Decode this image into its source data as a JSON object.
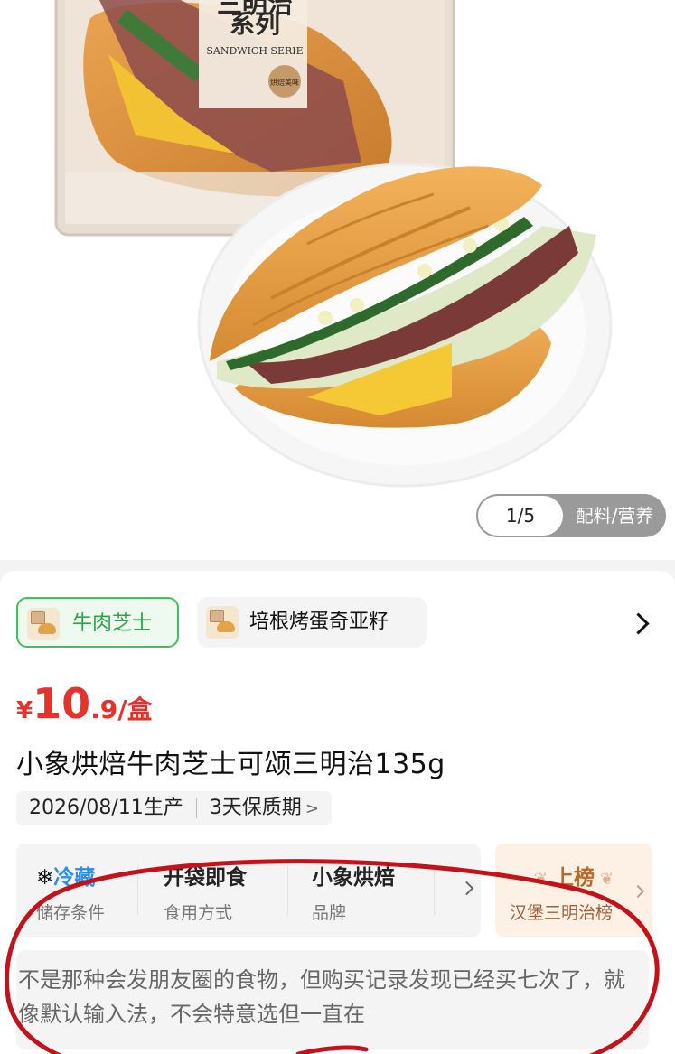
{
  "gallery": {
    "packaging_text_line1": "三明治",
    "packaging_text_line2": "系列",
    "packaging_subtitle": "SANDWICH SERIE",
    "packaging_badge": "烘焙美味",
    "page_indicator": "1/5",
    "ingredients_link": "配料/营养"
  },
  "variants": [
    {
      "label": "牛肉芝士",
      "selected": true
    },
    {
      "label": "培根烤蛋奇亚籽",
      "selected": false
    }
  ],
  "price": {
    "currency": "¥",
    "integer": "10",
    "decimal": ".9",
    "unit": "/盒"
  },
  "product": {
    "title": "小象烘焙牛肉芝士可颂三明治135g",
    "production_date": "2026/08/11生产",
    "shelf_life": "3天保质期"
  },
  "attributes": [
    {
      "value": "冷藏",
      "label": "储存条件",
      "icon": "snowflake-icon"
    },
    {
      "value": "开袋即食",
      "label": "食用方式"
    },
    {
      "value": "小象烘焙",
      "label": "品牌"
    }
  ],
  "ranking": {
    "title": "上榜",
    "subtitle": "汉堡三明治榜"
  },
  "review": {
    "text": "不是那种会发朋友圈的食物，但购买记录发现已经买七次了，就像默认输入法，不会特意选但一直在"
  },
  "colors": {
    "price": "#e5322b",
    "selected_variant": "#29a745",
    "cold_storage": "#2b8ff0",
    "ranking": "#b86a2a",
    "annotation_circle": "#c4121a"
  }
}
